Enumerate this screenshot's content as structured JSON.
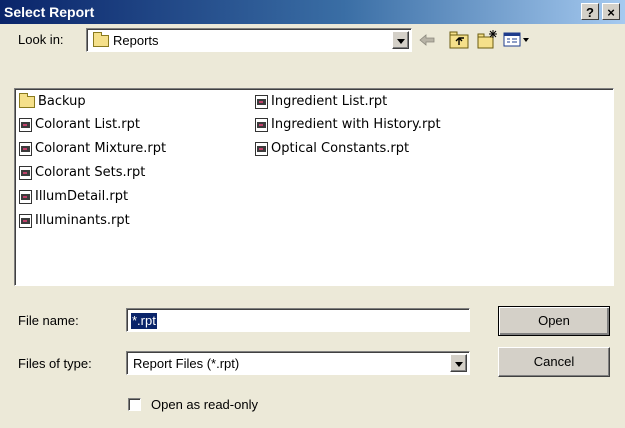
{
  "window": {
    "title": "Select Report",
    "help_label": "?",
    "close_label": "×"
  },
  "lookin": {
    "label": "Look in:",
    "value": "Reports"
  },
  "files": {
    "col1": [
      "Backup",
      "Colorant List.rpt",
      "Colorant Mixture.rpt",
      "Colorant Sets.rpt",
      "IllumDetail.rpt",
      "Illuminants.rpt"
    ],
    "col2": [
      "Ingredient List.rpt",
      "Ingredient with History.rpt",
      "Optical Constants.rpt"
    ]
  },
  "filename": {
    "label": "File name:",
    "value": "*.rpt"
  },
  "filetype": {
    "label": "Files of type:",
    "value": "Report Files (*.rpt)"
  },
  "readonly": {
    "label": "Open as read-only",
    "checked": false
  },
  "buttons": {
    "open": "Open",
    "cancel": "Cancel"
  },
  "icons": {
    "back": "back-arrow-icon",
    "up": "up-folder-icon",
    "new_folder": "new-folder-icon",
    "view": "view-menu-icon"
  },
  "colors": {
    "titlebar_start": "#0a246a",
    "titlebar_end": "#a6caf0",
    "selection": "#0a246a",
    "dialog_bg": "#ece9d8"
  }
}
